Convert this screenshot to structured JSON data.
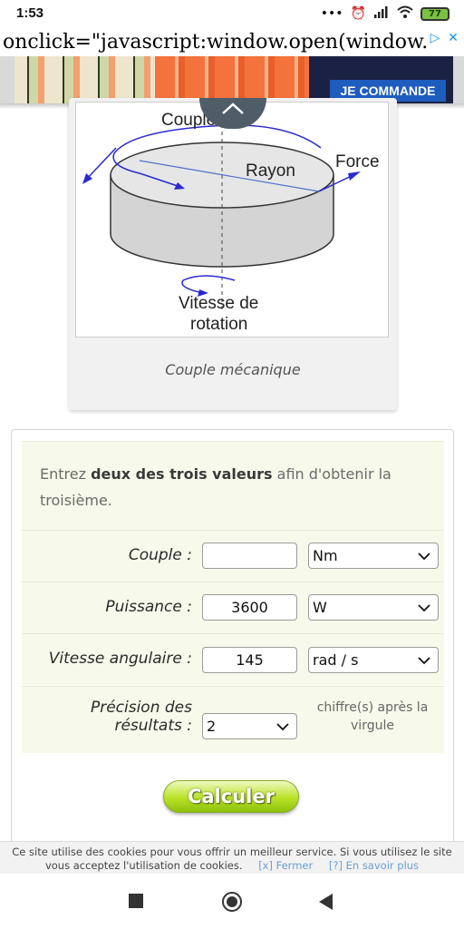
{
  "status_bar": {
    "time": "1:53",
    "icons": [
      "more-dots-icon",
      "alarm-icon",
      "signal-icon",
      "wifi-icon",
      "battery-icon"
    ],
    "battery_level": "77"
  },
  "ad": {
    "code_text": "onclick=\"javascript:window.open(window.",
    "cta_label": "JE COMMANDE",
    "adchoices_icon": "adchoices-icon",
    "close_icon": "close-icon"
  },
  "figure": {
    "labels": {
      "couple": "Couple",
      "rayon": "Rayon",
      "force": "Force",
      "vitesse_line1": "Vitesse de",
      "vitesse_line2": "rotation"
    },
    "caption": "Couple mécanique"
  },
  "calculator": {
    "intro_before": "Entrez ",
    "intro_bold": "deux des trois valeurs",
    "intro_after": " afin d'obtenir la troisième.",
    "rows": [
      {
        "label": "Couple :",
        "value": "",
        "unit": "Nm"
      },
      {
        "label": "Puissance :",
        "value": "3600",
        "unit": "W"
      },
      {
        "label": "Vitesse angulaire :",
        "value": "145",
        "unit": "rad / s"
      }
    ],
    "precision": {
      "label_line1": "Précision des",
      "label_line2": "résultats :",
      "value": "2",
      "note": "chiffre(s) après la virgule"
    },
    "button_label": "Calculer"
  },
  "cookie": {
    "text": "Ce site utilise des cookies pour vous offrir un meilleur service. Si vous utilisez le site vous acceptez l'utilisation de cookies.",
    "close_link": "[x] Fermer",
    "more_link": "[?] En savoir plus"
  },
  "colors": {
    "accent_green": "#b8e226",
    "row_background": "#f7f9ea",
    "link_blue": "#6aa0d8"
  }
}
